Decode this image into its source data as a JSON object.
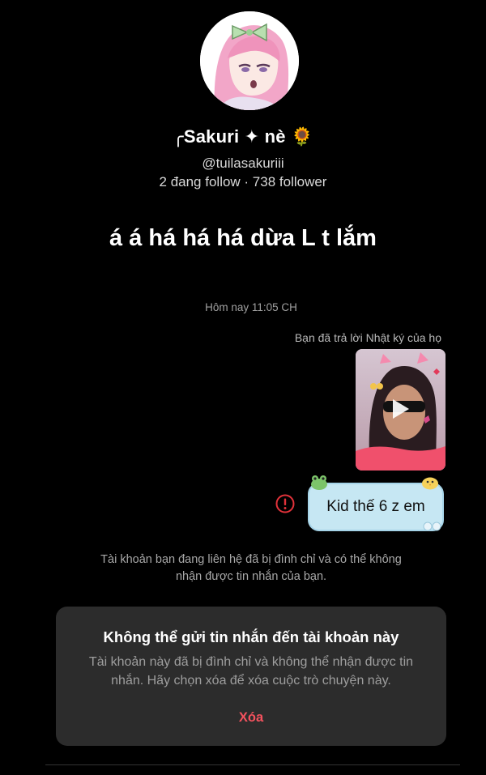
{
  "profile": {
    "display_name": "╭Sakuri ✦ nè 🌻",
    "username": "@tuilasakuriii",
    "stats": "2 đang follow · 738 follower",
    "status_note": "á á há há há dừa L t lắm"
  },
  "chat": {
    "timestamp": "Hôm nay 11:05 CH",
    "reply_note": "Bạn đã trả lời Nhật ký của họ",
    "message_text": "Kid thế 6 z em",
    "suspend_note": "Tài khoản bạn đang liên hệ đã bị đình chỉ và có thể không nhận được tin nhắn của bạn."
  },
  "modal": {
    "title": "Không thể gửi tin nhắn đến tài khoản này",
    "body": "Tài khoản này đã bị đình chỉ và không thể nhận được tin nhắn. Hãy chọn xóa để xóa cuộc trò chuyện này.",
    "delete_label": "Xóa"
  },
  "colors": {
    "background": "#000000",
    "bubble": "#c6e7f3",
    "modal": "#2c2c2c",
    "danger": "#f4525e",
    "error_icon": "#e2323a"
  },
  "icons": {
    "play": "play-icon",
    "error": "error-icon"
  }
}
